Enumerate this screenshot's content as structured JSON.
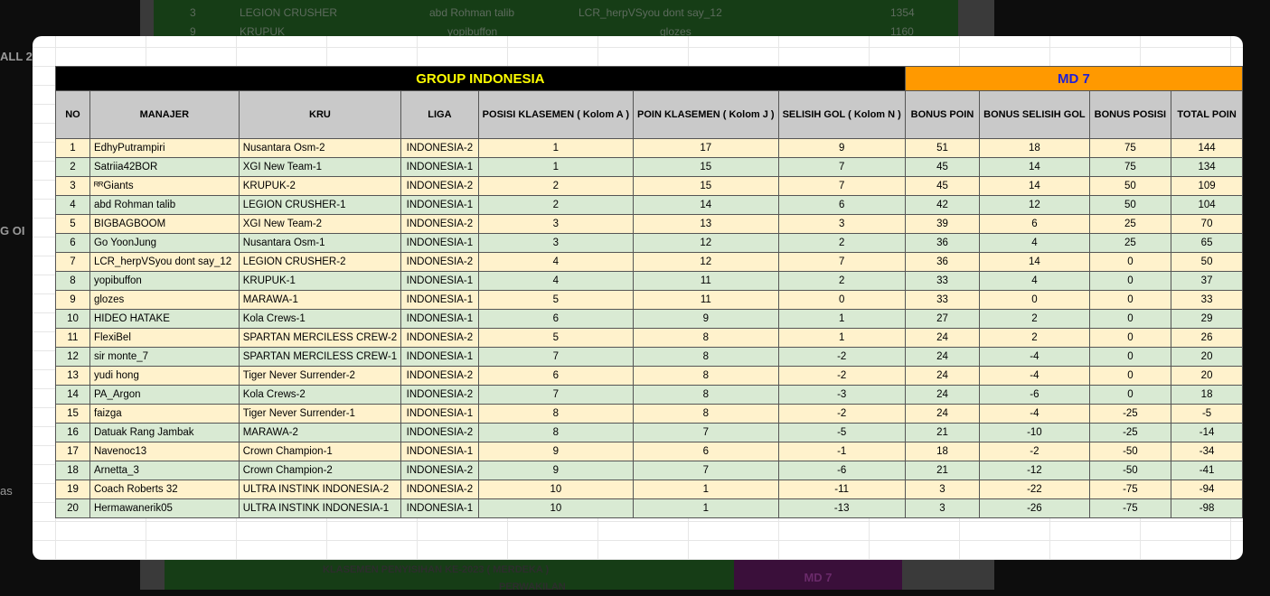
{
  "background": {
    "top_rows": [
      {
        "no": "3",
        "manager": "LEGION CRUSHER",
        "kru": "abd Rohman talib",
        "liga": "LCR_herpVSyou dont say_12",
        "points": "1354"
      },
      {
        "no": "9",
        "manager": "KRUPUK",
        "kru": "yopibuffon",
        "liga": "glozes",
        "points": "1160"
      }
    ],
    "left_labels": [
      "ALL 2",
      "G OI",
      "as"
    ],
    "bottom_title": "KLASEMEN PENYISIHAN KE-2023 ( MERDEKA )",
    "bottom_subtitle": "PERWAKILAN",
    "bottom_md": "MD 7"
  },
  "table": {
    "group_title": "GROUP INDONESIA",
    "md_title": "MD 7",
    "columns": [
      "NO",
      "MANAJER",
      "KRU",
      "LIGA",
      "POSISI KLASEMEN ( Kolom A )",
      "POIN KLASEMEN ( Kolom J )",
      "SELISIH GOL ( Kolom N )",
      "BONUS POIN",
      "BONUS SELISIH GOL",
      "BONUS POSISI",
      "TOTAL POIN"
    ],
    "rows": [
      [
        "1",
        "EdhyPutrampiri",
        "Nusantara Osm-2",
        "INDONESIA-2",
        "1",
        "17",
        "9",
        "51",
        "18",
        "75",
        "144"
      ],
      [
        "2",
        "Satriia42BOR",
        "XGI New Team-1",
        "INDONESIA-1",
        "1",
        "15",
        "7",
        "45",
        "14",
        "75",
        "134"
      ],
      [
        "3",
        "ᴿᴿGiants",
        "KRUPUK-2",
        "INDONESIA-2",
        "2",
        "15",
        "7",
        "45",
        "14",
        "50",
        "109"
      ],
      [
        "4",
        "abd Rohman talib",
        "LEGION CRUSHER-1",
        "INDONESIA-1",
        "2",
        "14",
        "6",
        "42",
        "12",
        "50",
        "104"
      ],
      [
        "5",
        "BIGBAGBOOM",
        "XGI New Team-2",
        "INDONESIA-2",
        "3",
        "13",
        "3",
        "39",
        "6",
        "25",
        "70"
      ],
      [
        "6",
        "Go YoonJung",
        "Nusantara Osm-1",
        "INDONESIA-1",
        "3",
        "12",
        "2",
        "36",
        "4",
        "25",
        "65"
      ],
      [
        "7",
        "LCR_herpVSyou dont say_12",
        "LEGION CRUSHER-2",
        "INDONESIA-2",
        "4",
        "12",
        "7",
        "36",
        "14",
        "0",
        "50"
      ],
      [
        "8",
        "yopibuffon",
        "KRUPUK-1",
        "INDONESIA-1",
        "4",
        "11",
        "2",
        "33",
        "4",
        "0",
        "37"
      ],
      [
        "9",
        "glozes",
        "MARAWA-1",
        "INDONESIA-1",
        "5",
        "11",
        "0",
        "33",
        "0",
        "0",
        "33"
      ],
      [
        "10",
        "HIDEO HATAKE",
        "Kola Crews-1",
        "INDONESIA-1",
        "6",
        "9",
        "1",
        "27",
        "2",
        "0",
        "29"
      ],
      [
        "11",
        "FlexiBel",
        "SPARTAN MERCILESS CREW-2",
        "INDONESIA-2",
        "5",
        "8",
        "1",
        "24",
        "2",
        "0",
        "26"
      ],
      [
        "12",
        "sir monte_7",
        "SPARTAN MERCILESS CREW-1",
        "INDONESIA-1",
        "7",
        "8",
        "-2",
        "24",
        "-4",
        "0",
        "20"
      ],
      [
        "13",
        "yudi hong",
        "Tiger Never Surrender-2",
        "INDONESIA-2",
        "6",
        "8",
        "-2",
        "24",
        "-4",
        "0",
        "20"
      ],
      [
        "14",
        "PA_Argon",
        "Kola Crews-2",
        "INDONESIA-2",
        "7",
        "8",
        "-3",
        "24",
        "-6",
        "0",
        "18"
      ],
      [
        "15",
        "faizga",
        "Tiger Never Surrender-1",
        "INDONESIA-1",
        "8",
        "8",
        "-2",
        "24",
        "-4",
        "-25",
        "-5"
      ],
      [
        "16",
        "Datuak Rang Jambak",
        "MARAWA-2",
        "INDONESIA-2",
        "8",
        "7",
        "-5",
        "21",
        "-10",
        "-25",
        "-14"
      ],
      [
        "17",
        "Navenoc13",
        "Crown Champion-1",
        "INDONESIA-1",
        "9",
        "6",
        "-1",
        "18",
        "-2",
        "-50",
        "-34"
      ],
      [
        "18",
        "Arnetta_3",
        "Crown Champion-2",
        "INDONESIA-2",
        "9",
        "7",
        "-6",
        "21",
        "-12",
        "-50",
        "-41"
      ],
      [
        "19",
        "Coach Roberts 32",
        "ULTRA INSTINK INDONESIA-2",
        "INDONESIA-2",
        "10",
        "1",
        "-11",
        "3",
        "-22",
        "-75",
        "-94"
      ],
      [
        "20",
        "Hermawanerik05",
        "ULTRA INSTINK INDONESIA-1",
        "INDONESIA-1",
        "10",
        "1",
        "-13",
        "3",
        "-26",
        "-75",
        "-98"
      ]
    ]
  }
}
